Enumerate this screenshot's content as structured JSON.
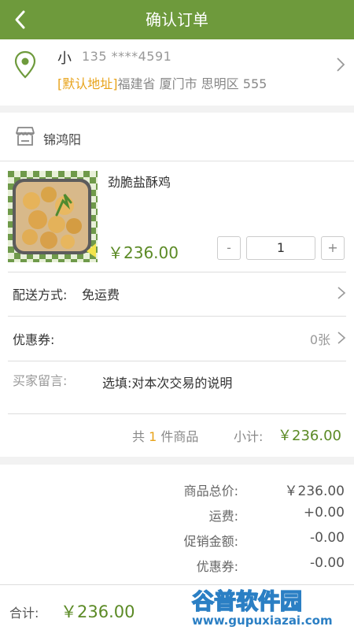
{
  "header": {
    "title": "确认订单"
  },
  "address": {
    "name": "小",
    "phone": "135 ****4591",
    "tag": "[默认地址]",
    "detail": "福建省 厦门市 思明区 555"
  },
  "shop": {
    "name": "锦鸿阳"
  },
  "product": {
    "name": "劲脆盐酥鸡",
    "price": "￥236.00",
    "quantity": "1",
    "minus": "-",
    "plus": "+"
  },
  "delivery": {
    "label": "配送方式:",
    "value": "免运费"
  },
  "coupon": {
    "label": "优惠券:",
    "value": "0张"
  },
  "message": {
    "label": "买家留言:",
    "placeholder": "选填:对本次交易的说明"
  },
  "count_line": {
    "prefix": "共",
    "count": "1",
    "suffix": "件商品",
    "subtotal_label": "小计:",
    "subtotal_value": "￥236.00"
  },
  "summary": [
    {
      "label": "商品总价:",
      "value": "￥236.00"
    },
    {
      "label": "运费:",
      "value": "+0.00"
    },
    {
      "label": "促销金额:",
      "value": "-0.00"
    },
    {
      "label": "优惠券:",
      "value": "-0.00"
    }
  ],
  "footer": {
    "total_label": "合计:",
    "total_value": "￥236.00"
  },
  "watermark": {
    "title": "谷普软件园",
    "url": "www.gupuxiazai.com"
  },
  "colors": {
    "brand_green": "#6e9a3c",
    "price_green": "#5b8a25",
    "tag_orange": "#e8a31a"
  }
}
